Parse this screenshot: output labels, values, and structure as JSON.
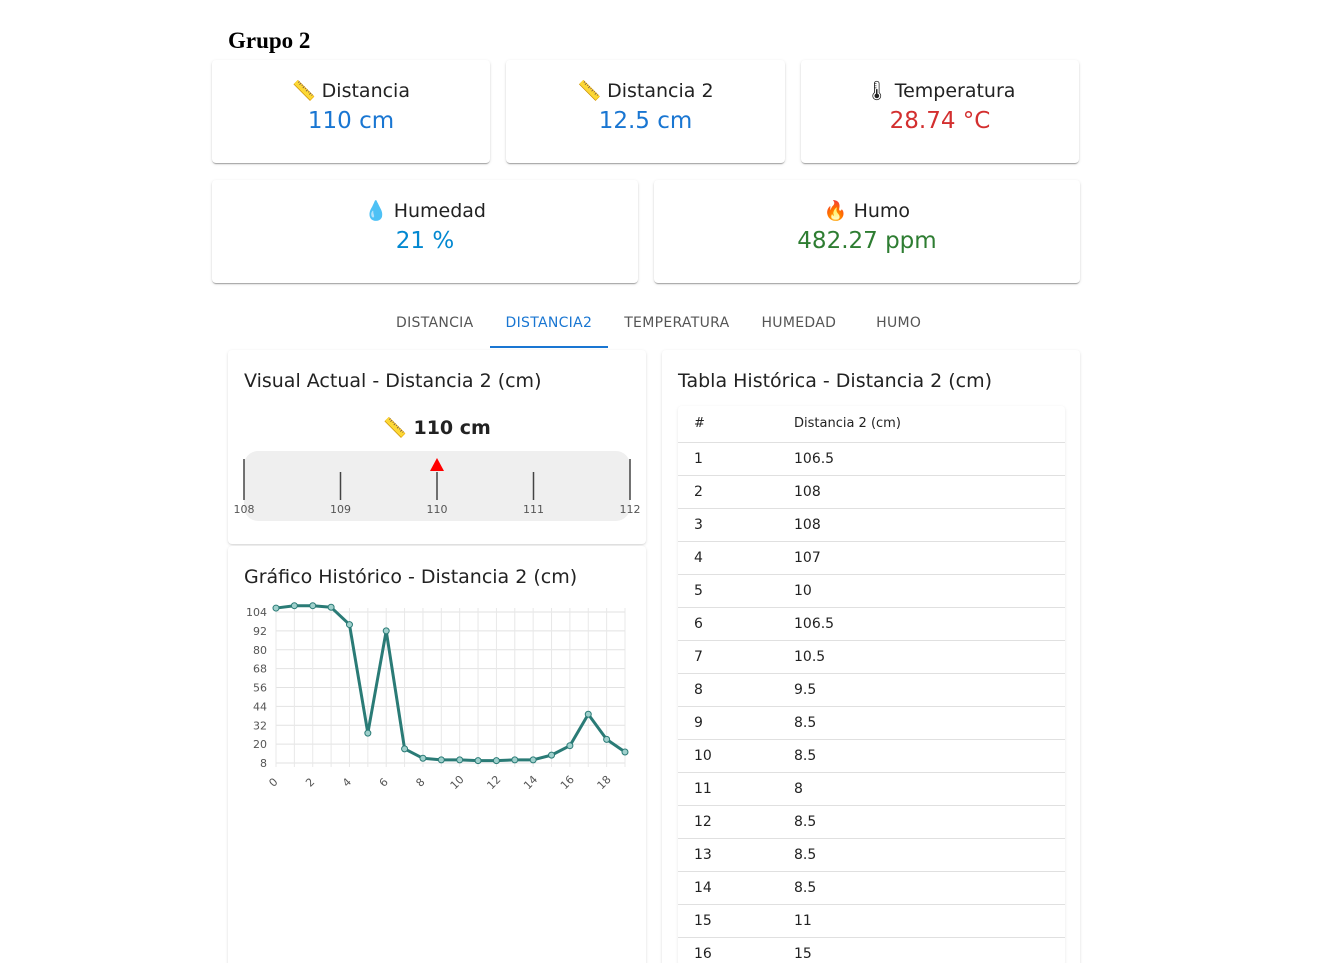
{
  "group_title": "Grupo 2",
  "sensors": [
    {
      "icon": "ruler-icon",
      "glyph": "📏",
      "label": "Distancia",
      "value": "110 cm",
      "color": "#1976d2"
    },
    {
      "icon": "ruler-icon",
      "glyph": "📏",
      "label": "Distancia 2",
      "value": "12.5 cm",
      "color": "#1976d2"
    },
    {
      "icon": "thermometer-icon",
      "glyph": "🌡",
      "label": "Temperatura",
      "value": "28.74 °C",
      "color": "#d32f2f"
    },
    {
      "icon": "droplet-icon",
      "glyph": "💧",
      "label": "Humedad",
      "value": "21 %",
      "color": "#0288d1"
    },
    {
      "icon": "fire-icon",
      "glyph": "🔥",
      "label": "Humo",
      "value": "482.27 ppm",
      "color": "#2e7d32"
    }
  ],
  "tabs": [
    "DISTANCIA",
    "DISTANCIA2",
    "TEMPERATURA",
    "HUMEDAD",
    "HUMO"
  ],
  "active_tab": 1,
  "visual": {
    "title": "Visual Actual - Distancia 2 (cm)",
    "glyph": "📏",
    "value_text": "110 cm",
    "ticks": [
      "108",
      "109",
      "110",
      "111",
      "112"
    ],
    "min": 108,
    "max": 112,
    "current": 110,
    "marker_color": "#ff0000"
  },
  "chart_title": "Gráfico Histórico - Distancia 2 (cm)",
  "chart_data": {
    "type": "line",
    "title": "",
    "x": [
      0,
      1,
      2,
      3,
      4,
      5,
      6,
      7,
      8,
      9,
      10,
      11,
      12,
      13,
      14,
      15,
      16,
      17,
      18,
      19
    ],
    "x_ticks": [
      "0",
      "2",
      "4",
      "6",
      "8",
      "10",
      "12",
      "14",
      "16",
      "18"
    ],
    "y_ticks": [
      "104",
      "92",
      "80",
      "68",
      "56",
      "44",
      "32",
      "20",
      "8"
    ],
    "ylim": [
      8,
      104
    ],
    "series": [
      {
        "values": [
          106.5,
          108,
          108,
          107,
          96,
          27,
          92,
          17,
          11,
          10,
          10,
          9.5,
          9.5,
          10,
          10,
          13,
          19,
          39,
          23,
          15
        ],
        "color": "#2a7b76"
      }
    ],
    "grid": true
  },
  "table": {
    "title": "Tabla Histórica - Distancia 2 (cm)",
    "headers": [
      "#",
      "Distancia 2 (cm)"
    ],
    "rows": [
      [
        "1",
        "106.5"
      ],
      [
        "2",
        "108"
      ],
      [
        "3",
        "108"
      ],
      [
        "4",
        "107"
      ],
      [
        "5",
        "10"
      ],
      [
        "6",
        "106.5"
      ],
      [
        "7",
        "10.5"
      ],
      [
        "8",
        "9.5"
      ],
      [
        "9",
        "8.5"
      ],
      [
        "10",
        "8.5"
      ],
      [
        "11",
        "8"
      ],
      [
        "12",
        "8.5"
      ],
      [
        "13",
        "8.5"
      ],
      [
        "14",
        "8.5"
      ],
      [
        "15",
        "11"
      ],
      [
        "16",
        "15"
      ]
    ]
  }
}
